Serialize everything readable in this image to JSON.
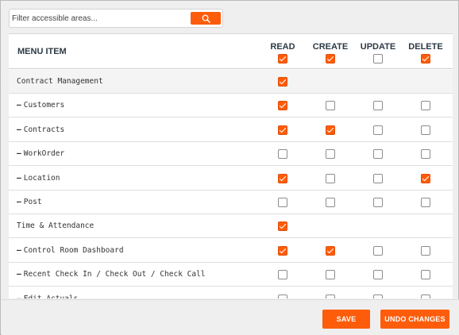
{
  "search": {
    "placeholder": "Filter accessible areas...",
    "value": ""
  },
  "header": {
    "menu_item": "MENU ITEM",
    "permissions": [
      {
        "label": "READ",
        "checked": true
      },
      {
        "label": "CREATE",
        "checked": true
      },
      {
        "label": "UPDATE",
        "checked": false
      },
      {
        "label": "DELETE",
        "checked": true
      }
    ]
  },
  "rows": [
    {
      "name": "Contract Management",
      "type": "group",
      "perms": [
        true
      ]
    },
    {
      "name": "Customers",
      "type": "item",
      "perms": [
        true,
        false,
        false,
        false
      ]
    },
    {
      "name": "Contracts",
      "type": "item",
      "perms": [
        true,
        true,
        false,
        false
      ]
    },
    {
      "name": "WorkOrder",
      "type": "item",
      "perms": [
        false,
        false,
        false,
        false
      ]
    },
    {
      "name": "Location",
      "type": "item",
      "perms": [
        true,
        false,
        false,
        true
      ]
    },
    {
      "name": "Post",
      "type": "item",
      "perms": [
        false,
        false,
        false,
        false
      ]
    },
    {
      "name": "Time & Attendance",
      "type": "group",
      "perms": [
        true
      ]
    },
    {
      "name": "Control Room Dashboard",
      "type": "item",
      "perms": [
        true,
        true,
        false,
        false
      ]
    },
    {
      "name": "Recent Check In / Check Out / Check Call",
      "type": "item",
      "perms": [
        false,
        false,
        false,
        false
      ]
    },
    {
      "name": "Edit Actuals",
      "type": "item",
      "perms": [
        false,
        false,
        false,
        false
      ]
    }
  ],
  "footer": {
    "save_label": "SAVE",
    "undo_label": "UNDO CHANGES"
  },
  "colors": {
    "accent": "#fd5c0b"
  },
  "icons": {
    "search_button": "search-icon",
    "item_prefix": "dash-icon"
  }
}
